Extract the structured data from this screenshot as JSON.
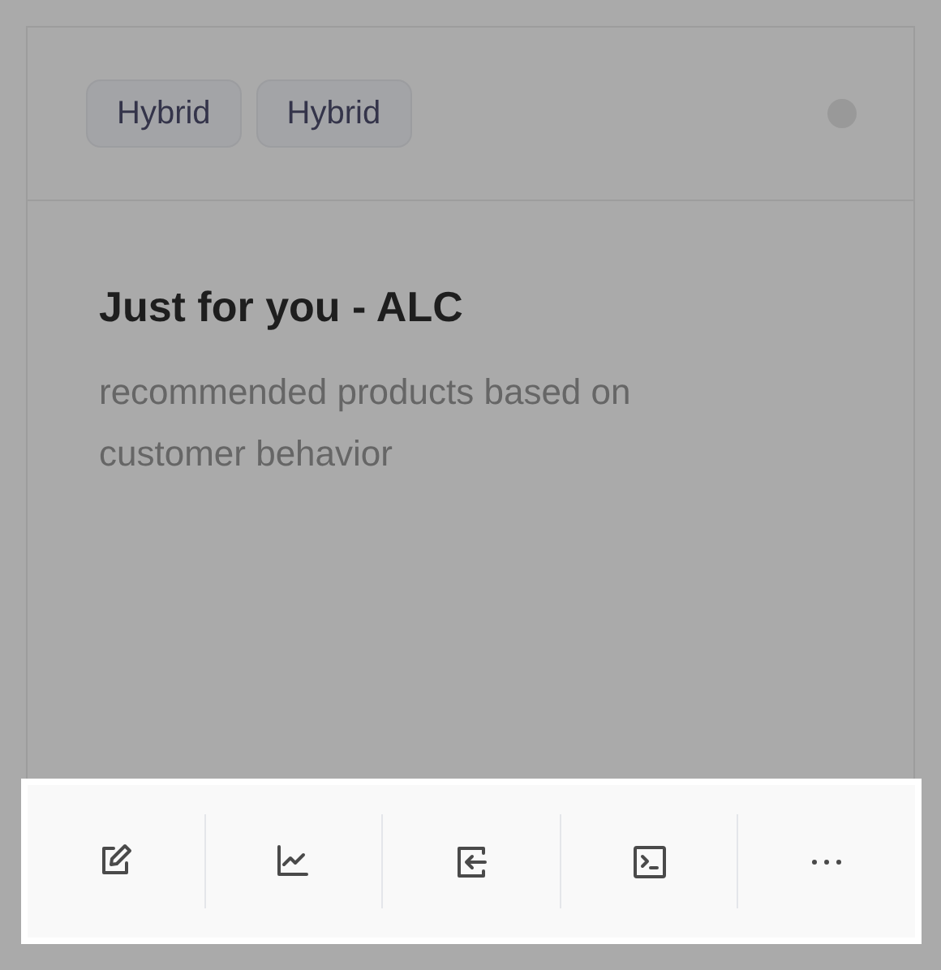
{
  "card": {
    "tags": [
      "Hybrid",
      "Hybrid"
    ],
    "title": "Just for you - ALC",
    "description": "recommended products based on customer behavior"
  },
  "actions": [
    {
      "kind": "edit"
    },
    {
      "kind": "chart"
    },
    {
      "kind": "import"
    },
    {
      "kind": "terminal"
    },
    {
      "kind": "more"
    }
  ]
}
